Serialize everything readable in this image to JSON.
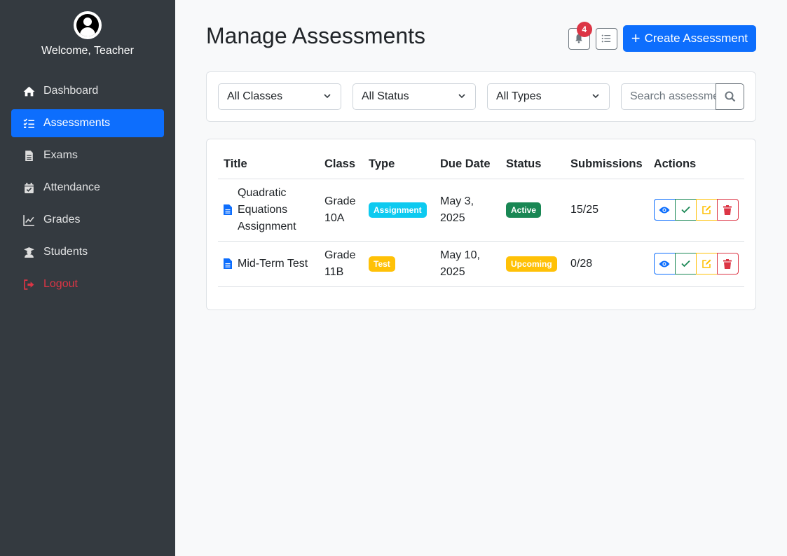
{
  "colors": {
    "sidebar_bg": "#343a40",
    "primary": "#0d6efd",
    "info": "#0dcaf0",
    "success": "#198754",
    "warning": "#ffc107",
    "danger": "#dc3545"
  },
  "sidebar": {
    "welcome": "Welcome, Teacher",
    "items": [
      {
        "label": "Dashboard",
        "icon": "home-icon"
      },
      {
        "label": "Assessments",
        "icon": "tasks-icon",
        "active": true
      },
      {
        "label": "Exams",
        "icon": "file-icon"
      },
      {
        "label": "Attendance",
        "icon": "calendar-check-icon"
      },
      {
        "label": "Grades",
        "icon": "chart-line-icon"
      },
      {
        "label": "Students",
        "icon": "user-graduate-icon"
      },
      {
        "label": "Logout",
        "icon": "sign-out-icon"
      }
    ]
  },
  "header": {
    "title": "Manage Assessments",
    "notification_count": "4",
    "create_label": "Create Assessment"
  },
  "filters": {
    "class_selected": "All Classes",
    "status_selected": "All Status",
    "type_selected": "All Types",
    "search_placeholder": "Search assessments..."
  },
  "table": {
    "headers": [
      "Title",
      "Class",
      "Type",
      "Due Date",
      "Status",
      "Submissions",
      "Actions"
    ],
    "rows": [
      {
        "title": "Quadratic Equations Assignment",
        "class": "Grade 10A",
        "type": "Assignment",
        "type_color": "#0dcaf0",
        "due": "May 3, 2025",
        "status": "Active",
        "status_color": "#198754",
        "submissions": "15/25"
      },
      {
        "title": "Mid-Term Test",
        "class": "Grade 11B",
        "type": "Test",
        "type_color": "#ffc107",
        "due": "May 10, 2025",
        "status": "Upcoming",
        "status_color": "#ffc107",
        "submissions": "0/28"
      }
    ]
  }
}
